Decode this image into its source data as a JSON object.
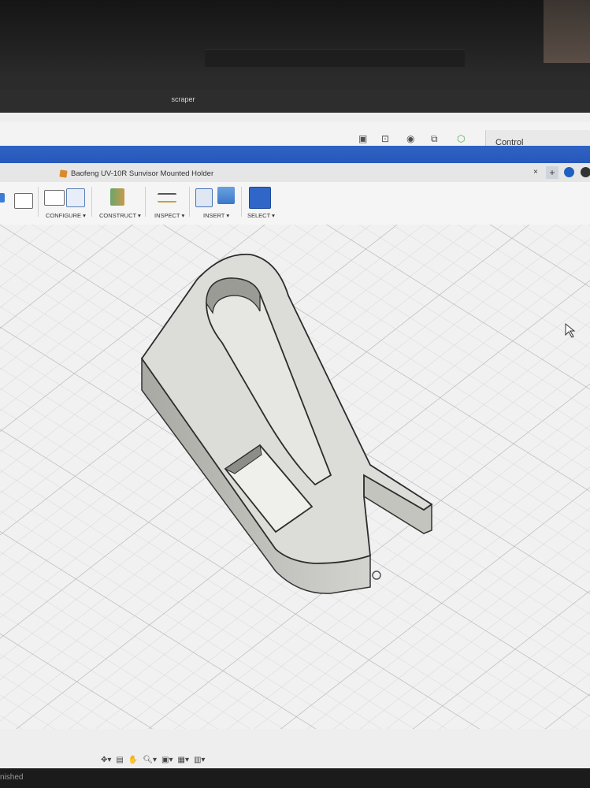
{
  "window": {
    "title": "scraper"
  },
  "header": {
    "control_label": "Control"
  },
  "document": {
    "tab_title": "Baofeng UV-10R Sunvisor Mounted Holder",
    "close_symbol": "×",
    "add_symbol": "+"
  },
  "toolbar": {
    "groups": [
      {
        "label": "CONFIGURE ▾"
      },
      {
        "label": "CONSTRUCT ▾"
      },
      {
        "label": "INSPECT ▾"
      },
      {
        "label": "INSERT ▾"
      },
      {
        "label": "SELECT ▾"
      }
    ]
  },
  "status": {
    "text": "nished"
  },
  "colors": {
    "accent": "#2658b8",
    "model": "#d9d9d5",
    "grid": "#c9c9c9"
  }
}
